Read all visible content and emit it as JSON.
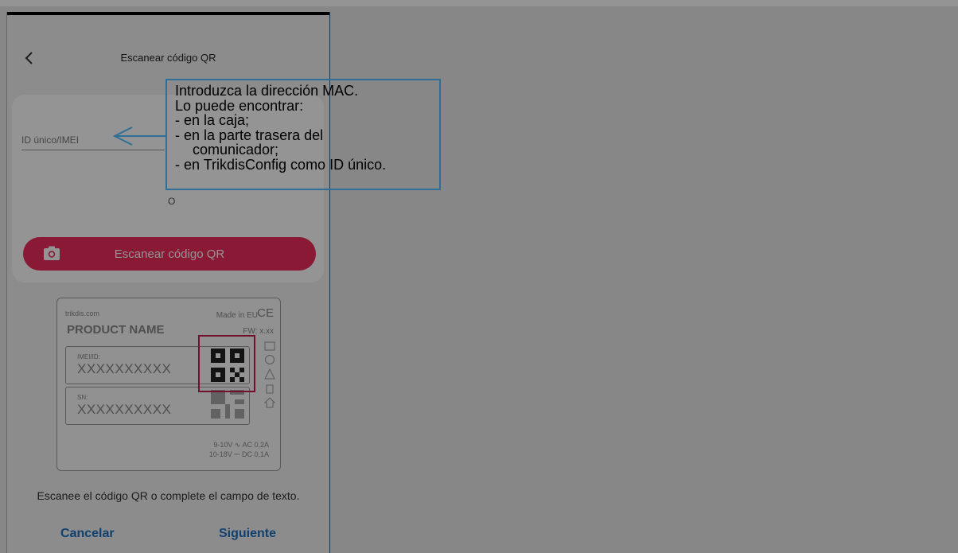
{
  "screen": {
    "title": "Escanear código QR",
    "id_input_placeholder": "ID único/IMEI",
    "or_text": "O",
    "scan_button_label": "Escanear código QR",
    "hint_text": "Escanee el código QR o complete el campo de texto.",
    "cancel_label": "Cancelar",
    "next_label": "Siguiente",
    "accent_color": "#ed2b5a",
    "link_color": "#1d6fc2"
  },
  "device_label": {
    "brand": "trikdis.com",
    "made_in": "Made in EU",
    "ce_mark": "CE",
    "product_name": "PRODUCT NAME",
    "fw": "FW: x.xx",
    "imei_key": "IMEI/ID:",
    "imei_value": "XXXXXXXXXX",
    "sn_key": "SN:",
    "sn_value": "XXXXXXXXXX",
    "rating_1": "9-10V ∿ AC 0,2A",
    "rating_2": "10-18V ⎓ DC 0,1A"
  },
  "callout": {
    "lines": [
      "Introduzca la dirección MAC.",
      "Lo puede encontrar:",
      "- en la caja;",
      "- en la parte trasera del",
      "   comunicador;",
      "- en TrikdisConfig como ID único."
    ],
    "border_color": "#2f6f96"
  },
  "icons": [
    "back-arrow-icon",
    "camera-icon",
    "qr-code-icon",
    "arrow-left-icon"
  ]
}
